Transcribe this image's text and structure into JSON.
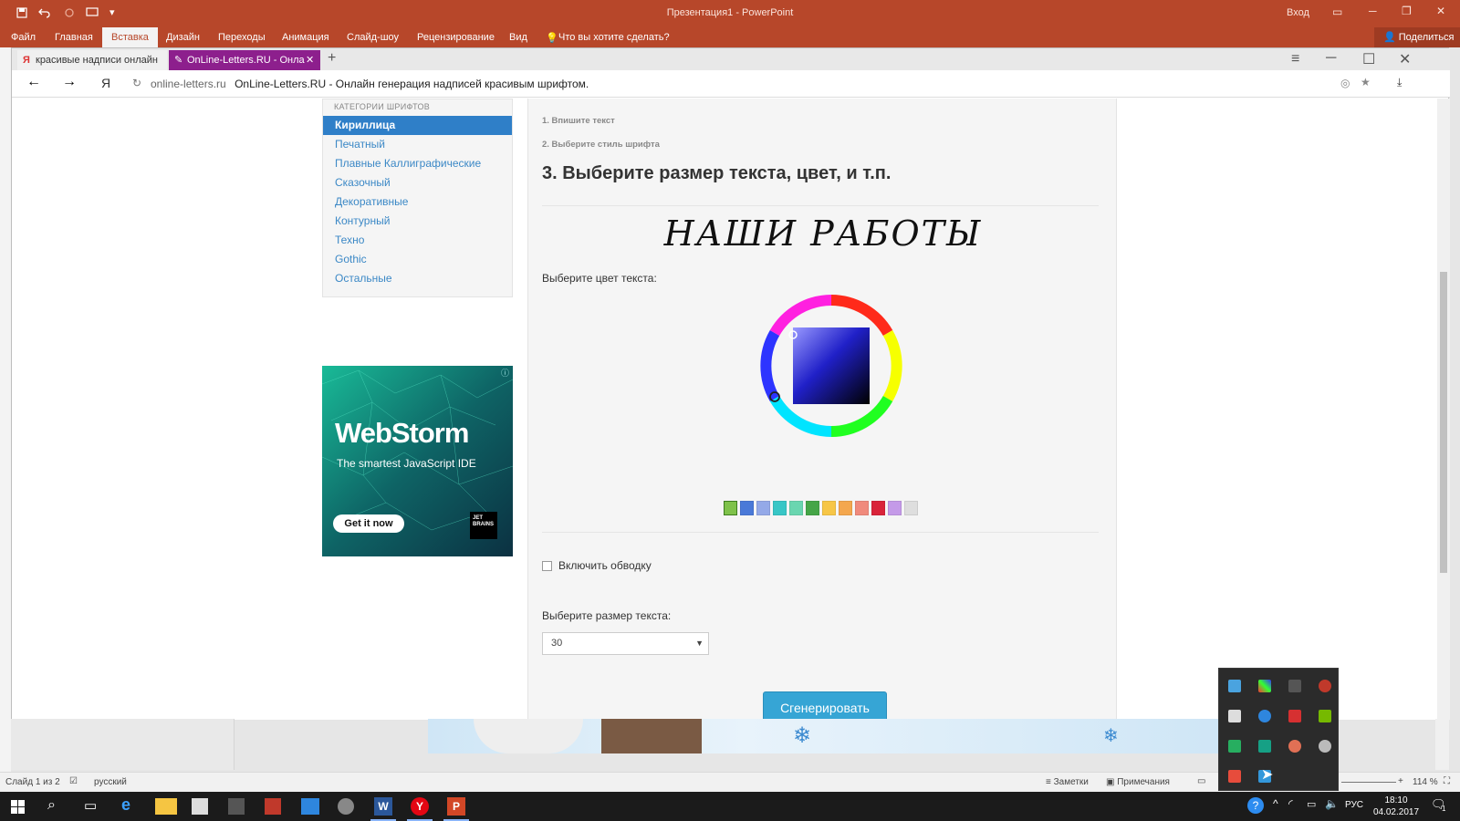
{
  "powerpoint": {
    "window_title": "Презентация1  -  PowerPoint",
    "sign_in": "Вход",
    "share": "Поделиться",
    "ribbon_tabs": [
      "Файл",
      "Главная",
      "Вставка",
      "Дизайн",
      "Переходы",
      "Анимация",
      "Слайд-шоу",
      "Рецензирование",
      "Вид"
    ],
    "active_tab": "Вставка",
    "tell_me": "Что вы хотите сделать?"
  },
  "browser": {
    "tabs": [
      {
        "label": "красивые надписи онлайн"
      },
      {
        "label": "OnLine-Letters.RU - Онла"
      }
    ],
    "address": {
      "domain": "online-letters.ru",
      "title": "OnLine-Letters.RU - Онлайн генерация надписей красивым шрифтом."
    }
  },
  "sidebar": {
    "header": "КАТЕГОРИИ ШРИФТОВ",
    "items": [
      "Кириллица",
      "Печатный",
      "Плавные Каллиграфические",
      "Сказочный",
      "Декоративные",
      "Контурный",
      "Техно",
      "Gothic",
      "Остальные"
    ],
    "active_index": 0
  },
  "ad": {
    "title": "WebStorm",
    "subtitle": "The smartest JavaScript IDE",
    "cta": "Get it now",
    "brand_line1": "JET",
    "brand_line2": "BRAINS"
  },
  "content": {
    "step1": "1. Впишите текст",
    "step2": "2. Выберите стиль шрифта",
    "step3": "3. Выберите размер текста, цвет, и т.п.",
    "preview_text": "НАШИ РАБОТЫ",
    "color_label": "Выберите цвет текста:",
    "swatches": [
      "#7fc24a",
      "#4a79d8",
      "#94a9e8",
      "#38c6c6",
      "#6ad6b0",
      "#45a547",
      "#f7c647",
      "#f4a74e",
      "#f08a7c",
      "#d9233a",
      "#c49ae8",
      "#dedede"
    ],
    "outline_label": "Включить обводку",
    "outline_checked": false,
    "size_label": "Выберите размер текста:",
    "size_value": "30",
    "generate_button": "Сгенерировать"
  },
  "statusbar": {
    "slide_info": "Слайд 1 из 2",
    "language": "русский",
    "notes": "Заметки",
    "comments": "Примечания",
    "zoom": "114 %"
  },
  "taskbar": {
    "lang": "РУС",
    "time": "18:10",
    "date": "04.02.2017",
    "notifications": "1"
  }
}
